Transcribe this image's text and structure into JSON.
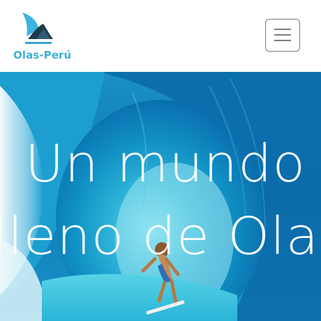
{
  "header": {
    "brand_name": "Olas-Perú",
    "logo_icon": "shark-fin-wave-logo",
    "menu_icon": "hamburger-menu-icon"
  },
  "hero": {
    "title_line1": "Un mundo",
    "title_line2": "lleno de Olas",
    "image": "surfer-in-wave-tube"
  },
  "colors": {
    "brand": "#3fb1d8",
    "logo_dark": "#1f3a4a",
    "wave_blue": "#0f86c2"
  }
}
